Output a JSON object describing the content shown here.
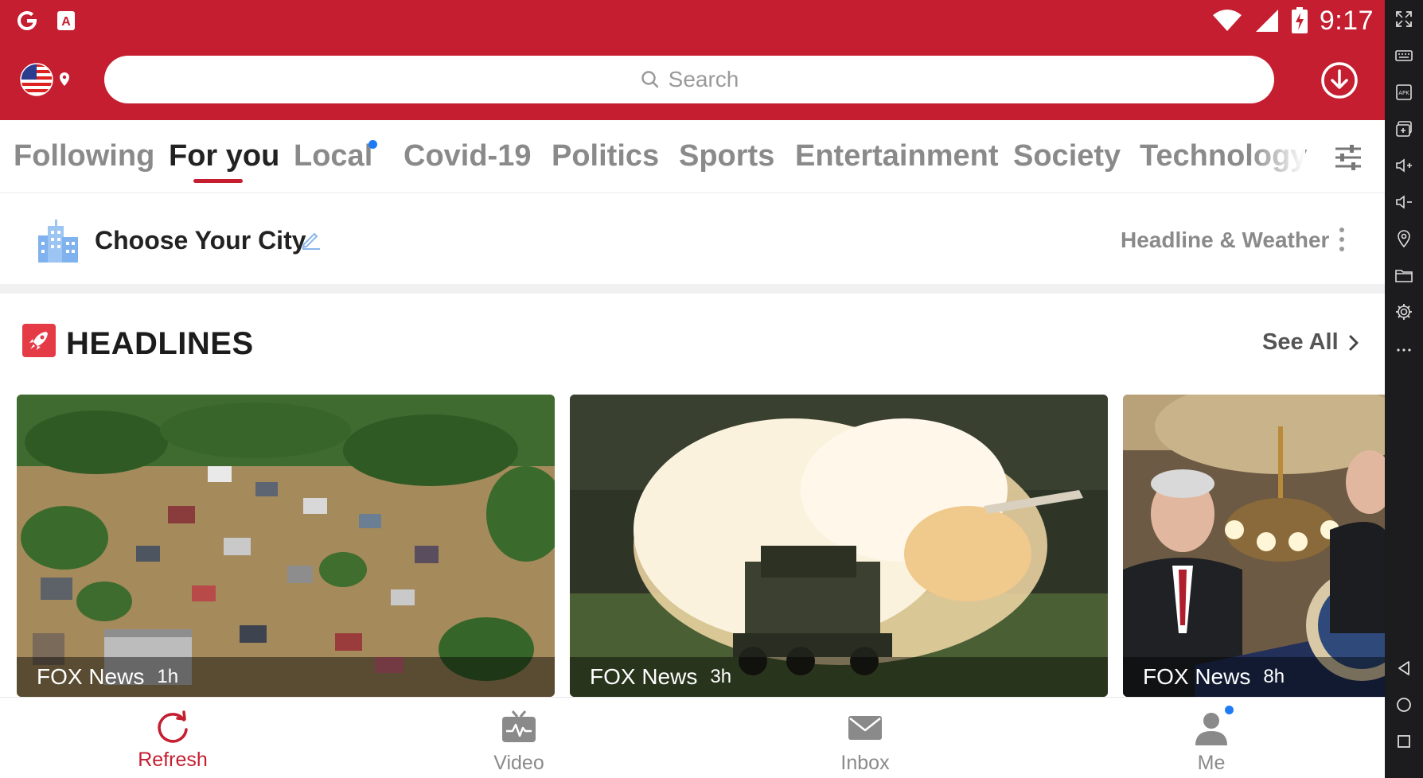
{
  "status_bar": {
    "time": "9:17",
    "left_icons": [
      "google-g-icon",
      "font-a-icon"
    ],
    "right_icons": [
      "wifi-icon",
      "signal-icon",
      "battery-charging-icon"
    ]
  },
  "header": {
    "search_placeholder": "Search",
    "accent_color": "#c41e30"
  },
  "tabs": [
    {
      "label": "Following"
    },
    {
      "label": "For you",
      "active": true
    },
    {
      "label": "Local",
      "has_dot": true
    },
    {
      "label": "Covid-19"
    },
    {
      "label": "Politics"
    },
    {
      "label": "Sports"
    },
    {
      "label": "Entertainment"
    },
    {
      "label": "Society"
    },
    {
      "label": "Technology"
    }
  ],
  "city": {
    "label": "Choose Your City",
    "right_label": "Headline & Weather"
  },
  "headlines": {
    "title": "HEADLINES",
    "see_all": "See All",
    "cards": [
      {
        "source": "FOX News",
        "time": "1h",
        "image": "flooded-town-aerial"
      },
      {
        "source": "FOX News",
        "time": "3h",
        "image": "rocket-launcher-firing"
      },
      {
        "source": "FOX News",
        "time": "8h",
        "image": "senators-press-conference"
      }
    ]
  },
  "bottom_nav": [
    {
      "label": "Refresh",
      "active": true
    },
    {
      "label": "Video"
    },
    {
      "label": "Inbox"
    },
    {
      "label": "Me",
      "has_dot": true
    }
  ]
}
